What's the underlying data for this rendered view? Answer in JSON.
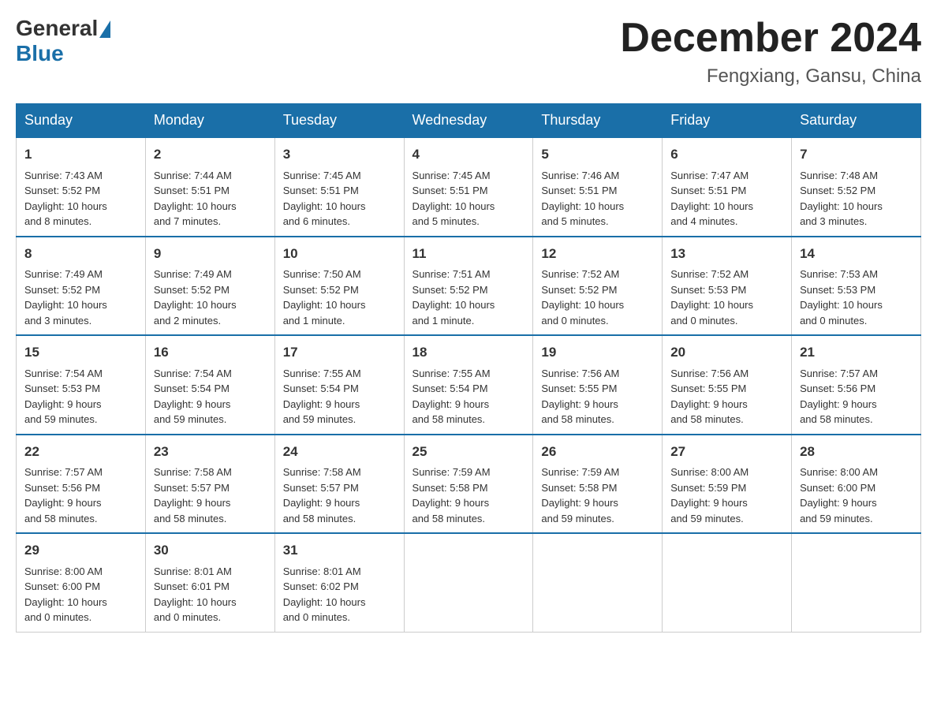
{
  "header": {
    "logo_general": "General",
    "logo_blue": "Blue",
    "month_title": "December 2024",
    "location": "Fengxiang, Gansu, China"
  },
  "weekdays": [
    "Sunday",
    "Monday",
    "Tuesday",
    "Wednesday",
    "Thursday",
    "Friday",
    "Saturday"
  ],
  "weeks": [
    [
      {
        "day": "1",
        "sunrise": "7:43 AM",
        "sunset": "5:52 PM",
        "daylight": "10 hours and 8 minutes."
      },
      {
        "day": "2",
        "sunrise": "7:44 AM",
        "sunset": "5:51 PM",
        "daylight": "10 hours and 7 minutes."
      },
      {
        "day": "3",
        "sunrise": "7:45 AM",
        "sunset": "5:51 PM",
        "daylight": "10 hours and 6 minutes."
      },
      {
        "day": "4",
        "sunrise": "7:45 AM",
        "sunset": "5:51 PM",
        "daylight": "10 hours and 5 minutes."
      },
      {
        "day": "5",
        "sunrise": "7:46 AM",
        "sunset": "5:51 PM",
        "daylight": "10 hours and 5 minutes."
      },
      {
        "day": "6",
        "sunrise": "7:47 AM",
        "sunset": "5:51 PM",
        "daylight": "10 hours and 4 minutes."
      },
      {
        "day": "7",
        "sunrise": "7:48 AM",
        "sunset": "5:52 PM",
        "daylight": "10 hours and 3 minutes."
      }
    ],
    [
      {
        "day": "8",
        "sunrise": "7:49 AM",
        "sunset": "5:52 PM",
        "daylight": "10 hours and 3 minutes."
      },
      {
        "day": "9",
        "sunrise": "7:49 AM",
        "sunset": "5:52 PM",
        "daylight": "10 hours and 2 minutes."
      },
      {
        "day": "10",
        "sunrise": "7:50 AM",
        "sunset": "5:52 PM",
        "daylight": "10 hours and 1 minute."
      },
      {
        "day": "11",
        "sunrise": "7:51 AM",
        "sunset": "5:52 PM",
        "daylight": "10 hours and 1 minute."
      },
      {
        "day": "12",
        "sunrise": "7:52 AM",
        "sunset": "5:52 PM",
        "daylight": "10 hours and 0 minutes."
      },
      {
        "day": "13",
        "sunrise": "7:52 AM",
        "sunset": "5:53 PM",
        "daylight": "10 hours and 0 minutes."
      },
      {
        "day": "14",
        "sunrise": "7:53 AM",
        "sunset": "5:53 PM",
        "daylight": "10 hours and 0 minutes."
      }
    ],
    [
      {
        "day": "15",
        "sunrise": "7:54 AM",
        "sunset": "5:53 PM",
        "daylight": "9 hours and 59 minutes."
      },
      {
        "day": "16",
        "sunrise": "7:54 AM",
        "sunset": "5:54 PM",
        "daylight": "9 hours and 59 minutes."
      },
      {
        "day": "17",
        "sunrise": "7:55 AM",
        "sunset": "5:54 PM",
        "daylight": "9 hours and 59 minutes."
      },
      {
        "day": "18",
        "sunrise": "7:55 AM",
        "sunset": "5:54 PM",
        "daylight": "9 hours and 58 minutes."
      },
      {
        "day": "19",
        "sunrise": "7:56 AM",
        "sunset": "5:55 PM",
        "daylight": "9 hours and 58 minutes."
      },
      {
        "day": "20",
        "sunrise": "7:56 AM",
        "sunset": "5:55 PM",
        "daylight": "9 hours and 58 minutes."
      },
      {
        "day": "21",
        "sunrise": "7:57 AM",
        "sunset": "5:56 PM",
        "daylight": "9 hours and 58 minutes."
      }
    ],
    [
      {
        "day": "22",
        "sunrise": "7:57 AM",
        "sunset": "5:56 PM",
        "daylight": "9 hours and 58 minutes."
      },
      {
        "day": "23",
        "sunrise": "7:58 AM",
        "sunset": "5:57 PM",
        "daylight": "9 hours and 58 minutes."
      },
      {
        "day": "24",
        "sunrise": "7:58 AM",
        "sunset": "5:57 PM",
        "daylight": "9 hours and 58 minutes."
      },
      {
        "day": "25",
        "sunrise": "7:59 AM",
        "sunset": "5:58 PM",
        "daylight": "9 hours and 58 minutes."
      },
      {
        "day": "26",
        "sunrise": "7:59 AM",
        "sunset": "5:58 PM",
        "daylight": "9 hours and 59 minutes."
      },
      {
        "day": "27",
        "sunrise": "8:00 AM",
        "sunset": "5:59 PM",
        "daylight": "9 hours and 59 minutes."
      },
      {
        "day": "28",
        "sunrise": "8:00 AM",
        "sunset": "6:00 PM",
        "daylight": "9 hours and 59 minutes."
      }
    ],
    [
      {
        "day": "29",
        "sunrise": "8:00 AM",
        "sunset": "6:00 PM",
        "daylight": "10 hours and 0 minutes."
      },
      {
        "day": "30",
        "sunrise": "8:01 AM",
        "sunset": "6:01 PM",
        "daylight": "10 hours and 0 minutes."
      },
      {
        "day": "31",
        "sunrise": "8:01 AM",
        "sunset": "6:02 PM",
        "daylight": "10 hours and 0 minutes."
      },
      null,
      null,
      null,
      null
    ]
  ],
  "labels": {
    "sunrise": "Sunrise:",
    "sunset": "Sunset:",
    "daylight": "Daylight:"
  }
}
